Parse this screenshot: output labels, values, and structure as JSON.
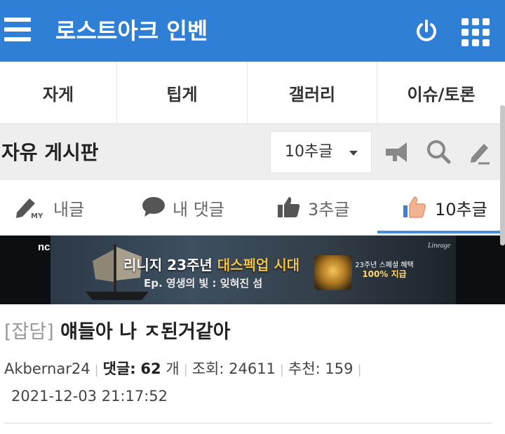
{
  "app": {
    "title": "로스트아크 인벤"
  },
  "categories": [
    {
      "label": "자게"
    },
    {
      "label": "팁게"
    },
    {
      "label": "갤러리"
    },
    {
      "label": "이슈/토론"
    }
  ],
  "board": {
    "title": "자유 게시판",
    "filter_value": "10추글"
  },
  "sub_tabs": [
    {
      "label": "내글",
      "icon": "pencil-my-icon"
    },
    {
      "label": "내 댓글",
      "icon": "speech-bubble-icon"
    },
    {
      "label": "3추글",
      "icon": "thumbs-up-icon"
    },
    {
      "label": "10추글",
      "icon": "thumbs-up-colored-icon"
    }
  ],
  "banner": {
    "brand": "nc",
    "game_logo": "Lineage",
    "headline_prefix": "리니지 23주년",
    "headline_highlight": "대스펙업 시대",
    "subline": "Ep. 영생의 빛 : 잊혀진 섬",
    "badge_line1": "23주년 스페셜 혜택",
    "badge_line2": "100% 지급"
  },
  "post": {
    "category": "[잡담]",
    "title": "얘들아 나 ㅈ된거같아",
    "author": "Akbernar24",
    "comments_label": "댓글:",
    "comments_count": "62",
    "comments_unit": "개",
    "views_text": "조회: 24611",
    "recommends_text": "추천: 159",
    "date": "2021-12-03 21:17:52"
  },
  "colors": {
    "topbar": "#2f7fd6",
    "active_tab_line": "#4a90d9",
    "banner_gold": "#f0c24a"
  }
}
